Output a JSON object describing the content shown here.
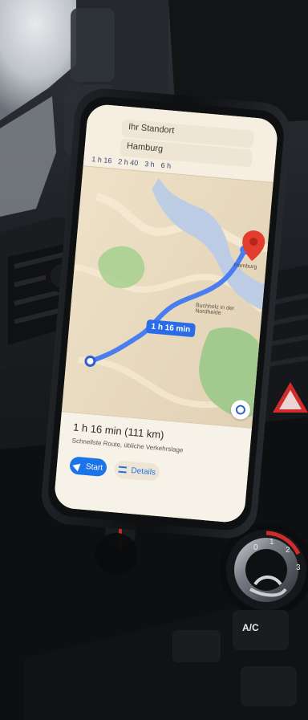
{
  "scene": {
    "description_free": true,
    "palette": {
      "dashboard_dark": "#0b0c0e",
      "dashboard_mid": "#202326",
      "window_light": "#d8dbe0",
      "map_bg": "#e9dcc4",
      "map_road": "#f5ead1",
      "map_green": "#9ec98b",
      "map_water": "#b9cbe6",
      "route_blue": "#4a7ef0",
      "marker_red": "#e23d2f",
      "phone_black": "#0f1012",
      "holder_black": "#121214",
      "accent_red": "#d12b2b"
    }
  },
  "phone": {
    "status_time": "",
    "search_from": "Ihr Standort",
    "search_to": "Hamburg",
    "transport_modes": [
      "1 h 16",
      "2 h 40",
      "3 h",
      "6 h"
    ],
    "route_badge": "1 h 16 min",
    "summary_title": "1 h 16 min (111 km)",
    "summary_sub": "Schnellste Route, übliche Verkehrslage",
    "start_label": "Start",
    "details_label": "Details",
    "map_labels": [
      "Buchholz in der Nordheide",
      "Hamburg"
    ]
  },
  "dashboard": {
    "hvac_ring_labels": [
      "0",
      "1",
      "2",
      "3"
    ],
    "ac_label": "A/C"
  }
}
